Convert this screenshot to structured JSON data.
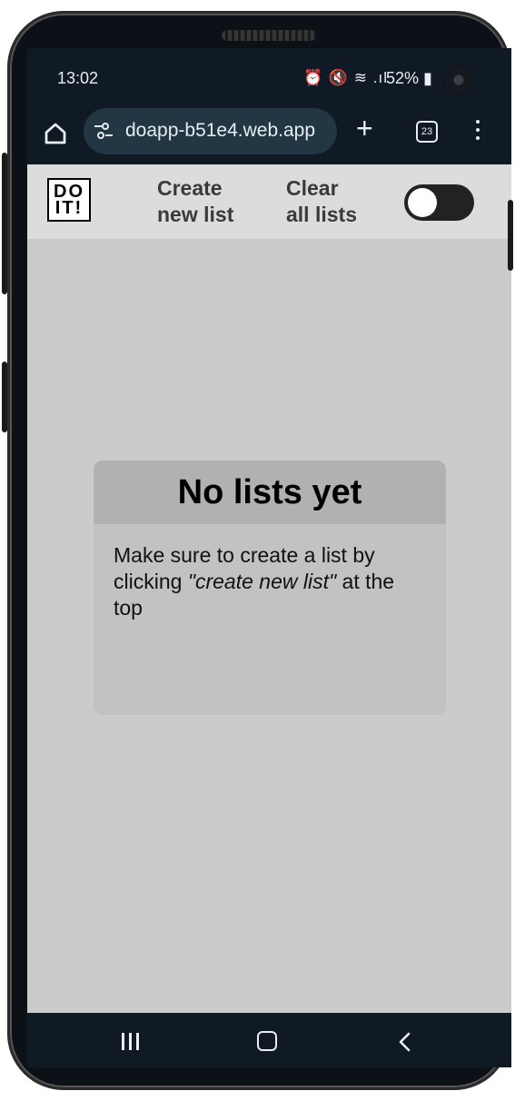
{
  "status_bar": {
    "time": "13:02",
    "indicator_glyphs": "⏰ 🔇 ≋ .ıl",
    "battery": "52%"
  },
  "browser": {
    "url": "doapp-b51e4.web.app",
    "new_tab_glyph": "+",
    "tab_count": "23"
  },
  "app": {
    "logo_line1": "DO",
    "logo_line2": "IT!",
    "create_link": "Create\nnew list",
    "clear_link": "Clear\nall lists",
    "dark_mode_toggle": "off"
  },
  "empty_state": {
    "title": "No lists yet",
    "text_before": "Make sure to create a list by clicking ",
    "text_emphasis": "\"create new list\"",
    "text_after": " at the top"
  },
  "colors": {
    "content_bg": "#cbcbcb",
    "header_bg": "#dcdcdc",
    "card_bg": "#c2c2c2",
    "card_head_bg": "#b1b1b1",
    "system_bar": "#0f1a24"
  }
}
